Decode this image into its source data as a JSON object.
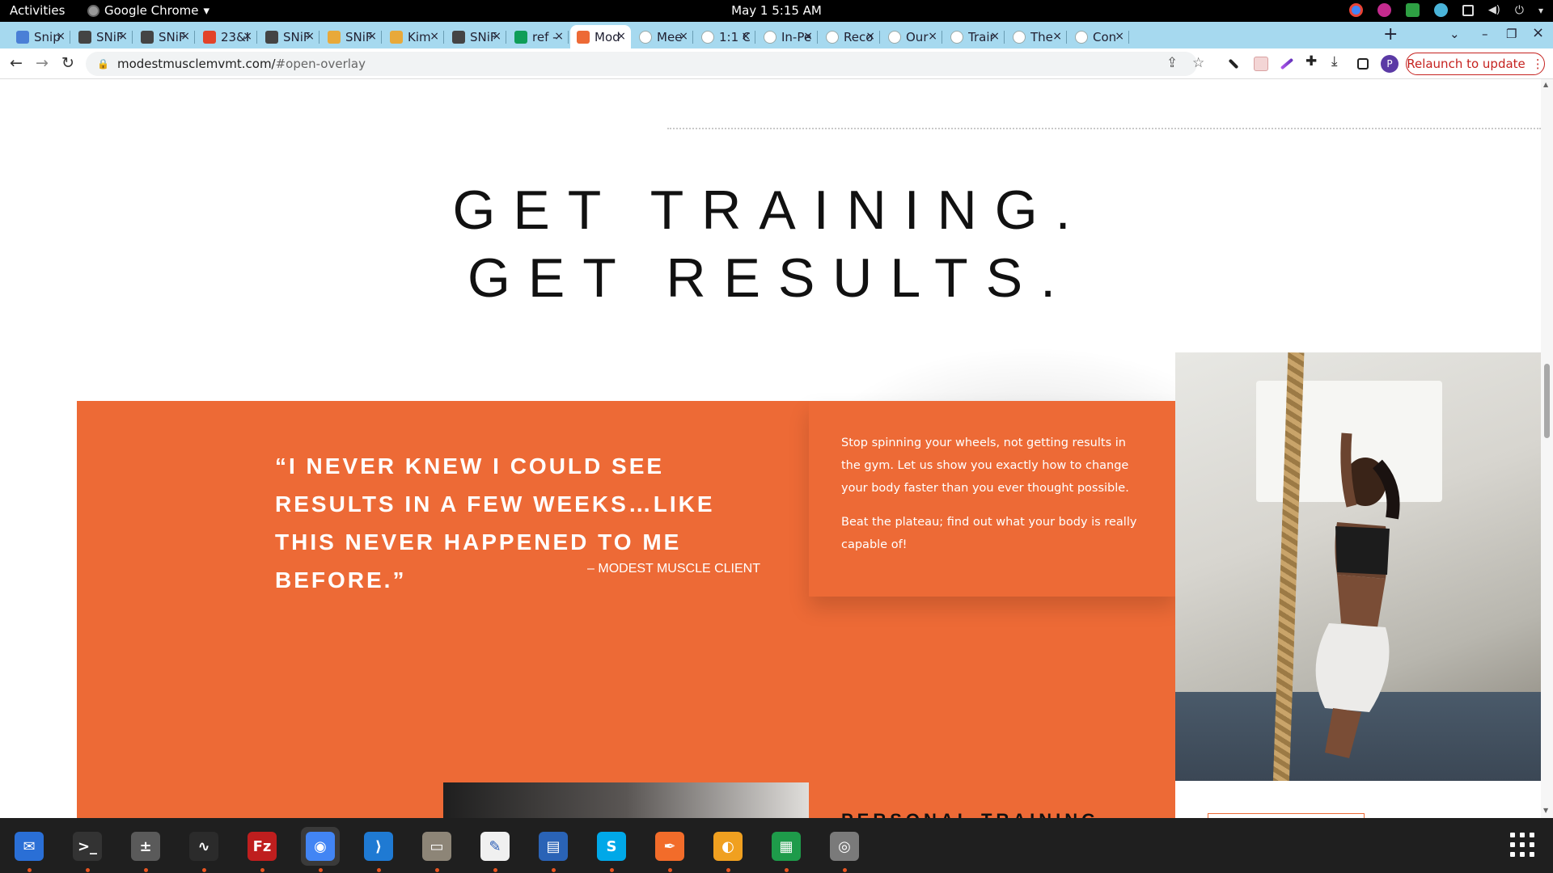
{
  "system": {
    "activities": "Activities",
    "app_name": "Google Chrome",
    "app_menu_icon": "chevron-down-icon",
    "clock": "May 1  5:15 AM",
    "tray_icons": [
      "chrome-icon",
      "app-icon",
      "extension-icon",
      "cross-icon",
      "network-icon",
      "volume-icon",
      "power-icon",
      "chevron-down-icon"
    ]
  },
  "tabs": [
    {
      "title": "Snip",
      "favicon_color": "#4a7fd6",
      "active": false
    },
    {
      "title": "SNiF",
      "favicon_color": "#444444",
      "active": false
    },
    {
      "title": "SNiF",
      "favicon_color": "#444444",
      "active": false
    },
    {
      "title": "23&I",
      "favicon_color": "#e24329",
      "active": false
    },
    {
      "title": "SNiF",
      "favicon_color": "#444444",
      "active": false
    },
    {
      "title": "SNiF",
      "favicon_color": "#e8a93a",
      "active": false
    },
    {
      "title": "Kim",
      "favicon_color": "#e8a93a",
      "active": false
    },
    {
      "title": "SNiF",
      "favicon_color": "#444444",
      "active": false
    },
    {
      "title": "ref -",
      "favicon_color": "#0f9d58",
      "active": false
    },
    {
      "title": "Mod",
      "favicon_color": "#ed6a36",
      "active": true
    },
    {
      "title": "Mee",
      "favicon_color": "#ffffff",
      "active": false
    },
    {
      "title": "1:1 C",
      "favicon_color": "#ffffff",
      "active": false
    },
    {
      "title": "In-Pe",
      "favicon_color": "#ffffff",
      "active": false
    },
    {
      "title": "Reco",
      "favicon_color": "#ffffff",
      "active": false
    },
    {
      "title": "Our",
      "favicon_color": "#ffffff",
      "active": false
    },
    {
      "title": "Trair",
      "favicon_color": "#ffffff",
      "active": false
    },
    {
      "title": "The",
      "favicon_color": "#ffffff",
      "active": false
    },
    {
      "title": "Con",
      "favicon_color": "#ffffff",
      "active": false
    }
  ],
  "tab_close_glyph": "×",
  "new_tab_glyph": "+",
  "window_controls": {
    "tab_search": "⌄",
    "minimize": "–",
    "restore": "❐",
    "close": "×"
  },
  "toolbar": {
    "back": "←",
    "forward": "→",
    "reload": "↻",
    "url_host": "modestmusclemvmt.com/",
    "url_path": "#open-overlay",
    "share_icon": "share-icon",
    "bookmark_icon": "star-icon",
    "extensions": [
      "eyedropper-icon",
      "calendar-icon",
      "pen-icon",
      "puzzle-icon",
      "download-icon",
      "sidepanel-icon"
    ],
    "profile_initial": "P",
    "relaunch_label": "Relaunch to update"
  },
  "page": {
    "headline_line1": "GET TRAINING.",
    "headline_line2": "GET RESULTS.",
    "quote": "“I NEVER KNEW I COULD SEE RESULTS IN A FEW WEEKS…LIKE THIS NEVER HAPPENED TO ME BEFORE.”",
    "attribution": "– MODEST MUSCLE CLIENT",
    "paragraph1": "Stop spinning your wheels, not getting results in the gym. Let us show you exactly how to change your body faster than you ever thought possible.",
    "paragraph2": "Beat the plateau; find out what your body is really capable of!",
    "section_heading": "PERSONAL TRAINING",
    "accent_color": "#ed6a36"
  },
  "dock": [
    {
      "name": "thunderbird-icon",
      "color": "#2a6fd6",
      "glyph": "✉"
    },
    {
      "name": "terminal-icon",
      "color": "#333333",
      "glyph": ">_"
    },
    {
      "name": "calculator-icon",
      "color": "#5a5a5a",
      "glyph": "±"
    },
    {
      "name": "system-monitor-icon",
      "color": "#2b2b2b",
      "glyph": "∿"
    },
    {
      "name": "filezilla-icon",
      "color": "#bf1e1e",
      "glyph": "Fz"
    },
    {
      "name": "chrome-icon",
      "color": "#4285f4",
      "glyph": "◉",
      "active": true
    },
    {
      "name": "vscode-icon",
      "color": "#1f7ad3",
      "glyph": "⟩"
    },
    {
      "name": "files-icon",
      "color": "#8d8577",
      "glyph": "▭"
    },
    {
      "name": "text-editor-icon",
      "color": "#f0f0f0",
      "glyph": "✎"
    },
    {
      "name": "libreoffice-impress-icon",
      "color": "#2a63b6",
      "glyph": "▤"
    },
    {
      "name": "skype-icon",
      "color": "#00a8e8",
      "glyph": "S"
    },
    {
      "name": "inkscape-icon",
      "color": "#f26c2a",
      "glyph": "✒"
    },
    {
      "name": "blender-icon",
      "color": "#f0a020",
      "glyph": "◐"
    },
    {
      "name": "libreoffice-calc-icon",
      "color": "#1e9b4a",
      "glyph": "▦"
    },
    {
      "name": "disk-icon",
      "color": "#7a7a7a",
      "glyph": "◎"
    }
  ]
}
